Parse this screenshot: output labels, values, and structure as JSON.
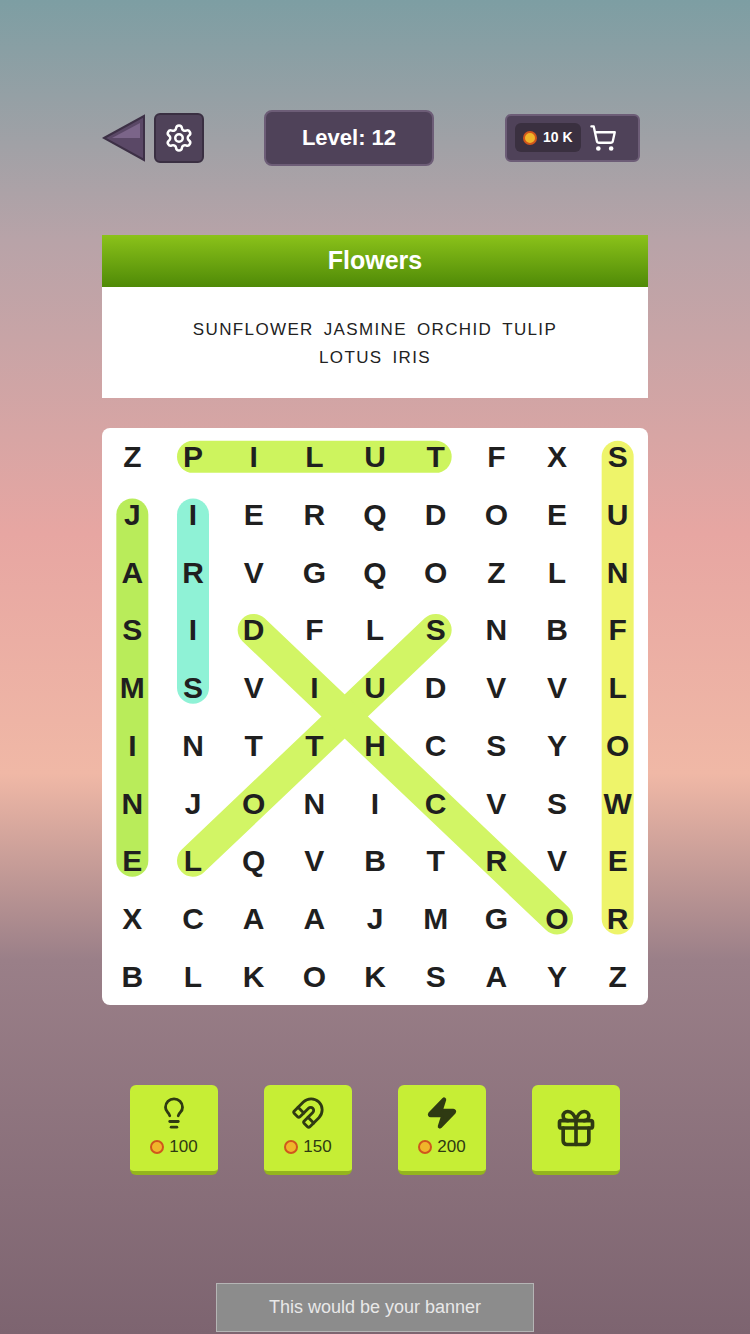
{
  "top_bar": {
    "level": "Level: 12",
    "coins": "10 K"
  },
  "category": "Flowers",
  "words": [
    "SUNFLOWER",
    "JASMINE",
    "ORCHID",
    "TULIP",
    "LOTUS",
    "IRIS"
  ],
  "grid": [
    "ZPILUTFXS",
    "JIERQDOEU",
    "ARVGQOZLN",
    "SIDFLSNBF",
    "MSVIUDVVL",
    "INTTHCSYO",
    "NJONICVSW",
    "ELQVBTRVE",
    "XCAAJMGOR",
    "BLKOKSAYZ"
  ],
  "highlights": [
    {
      "from": [
        0,
        5
      ],
      "to": [
        0,
        1
      ],
      "color": "#cdf45e"
    },
    {
      "from": [
        0,
        8
      ],
      "to": [
        8,
        8
      ],
      "color": "#eef46a"
    },
    {
      "from": [
        1,
        0
      ],
      "to": [
        7,
        0
      ],
      "color": "#b9ec5a"
    },
    {
      "from": [
        1,
        1
      ],
      "to": [
        4,
        1
      ],
      "color": "#8ff2d6"
    },
    {
      "from": [
        7,
        1
      ],
      "to": [
        3,
        5
      ],
      "color": "#d2f565"
    },
    {
      "from": [
        8,
        7
      ],
      "to": [
        3,
        2
      ],
      "color": "#d2f565"
    }
  ],
  "powerups": [
    {
      "kind": "hint",
      "price": "100"
    },
    {
      "kind": "magnet",
      "price": "150"
    },
    {
      "kind": "bolt",
      "price": "200"
    },
    {
      "kind": "video",
      "price": ""
    }
  ],
  "banner": "This would be your banner"
}
